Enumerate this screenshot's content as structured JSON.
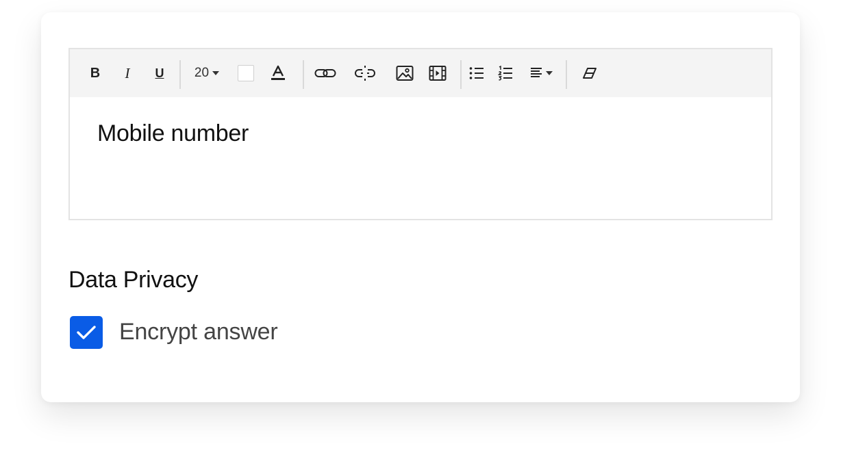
{
  "editor": {
    "toolbar": {
      "bold_label": "B",
      "italic_label": "I",
      "underline_label": "U",
      "font_size": "20"
    },
    "content": "Mobile number"
  },
  "privacy": {
    "title": "Data Privacy",
    "encrypt_label": "Encrypt answer",
    "encrypt_checked": true
  },
  "colors": {
    "accent": "#0a5ce6",
    "toolbar_bg": "#f4f4f4",
    "border": "#e3e3e3"
  },
  "icons": {
    "link": "link-icon",
    "unlink": "unlink-icon",
    "image": "image-icon",
    "video": "video-icon",
    "bullet_list": "bullet-list-icon",
    "numbered_list": "numbered-list-icon",
    "align": "align-icon",
    "clear_format": "eraser-icon",
    "text_color": "text-color-icon",
    "background_color": "background-color-swatch"
  }
}
